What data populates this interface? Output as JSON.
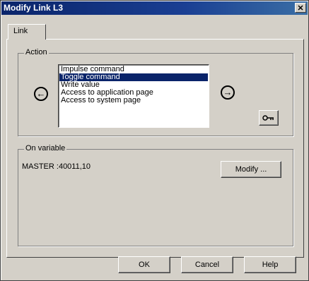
{
  "window": {
    "title": "Modify Link L3",
    "close_glyph": "✕"
  },
  "tabs": [
    {
      "label": "Link"
    }
  ],
  "action": {
    "group_label": "Action",
    "items": [
      {
        "label": "Impulse command",
        "selected": false
      },
      {
        "label": "Toggle command",
        "selected": true
      },
      {
        "label": "Write value",
        "selected": false
      },
      {
        "label": "Access to application page",
        "selected": false
      },
      {
        "label": "Access to system page",
        "selected": false
      }
    ],
    "left_arrow_icon": "arrow-left-icon",
    "right_arrow_icon": "arrow-right-icon",
    "key_icon": "key-icon"
  },
  "variable": {
    "group_label": "On variable",
    "value": "MASTER :40011,10",
    "modify_label": "Modify ..."
  },
  "buttons": {
    "ok": "OK",
    "cancel": "Cancel",
    "help": "Help"
  },
  "colors": {
    "titlebar": "#0a246a",
    "selection": "#0a246a",
    "face": "#d4d0c8"
  }
}
